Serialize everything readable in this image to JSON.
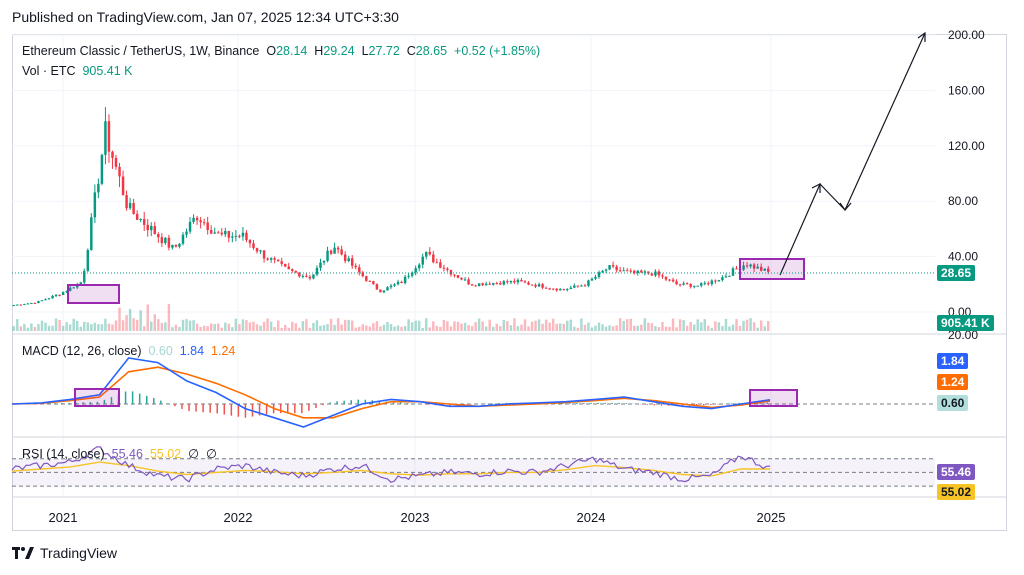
{
  "published": "Published on TradingView.com, Jan 07, 2025 12:34 UTC+3:30",
  "legend": {
    "symbol": "Ethereum Classic / TetherUS, 1W, Binance",
    "o_label": "O",
    "o": "28.14",
    "h_label": "H",
    "h": "29.24",
    "l_label": "L",
    "l": "27.72",
    "c_label": "C",
    "c": "28.65",
    "change": "+0.52 (+1.85%)",
    "vol_label": "Vol · ETC",
    "vol": "905.41 K"
  },
  "macd_legend": {
    "label": "MACD (12, 26, close)",
    "hist": "0.60",
    "macd": "1.84",
    "signal": "1.24"
  },
  "rsi_legend": {
    "label": "RSI (14, close)",
    "rsi": "55.46",
    "ma": "55.02",
    "v3": "∅",
    "v4": "∅"
  },
  "price_badge": "28.65",
  "vol_badge": "905.41 K",
  "macd_badges": [
    "1.84",
    "1.24",
    "0.60"
  ],
  "rsi_badges": [
    "55.46",
    "55.02"
  ],
  "x_labels": [
    "2021",
    "2022",
    "2023",
    "2024",
    "2025"
  ],
  "logo_text": "TradingView",
  "colors": {
    "up": "#089981",
    "down": "#f23645",
    "macd": "#2962ff",
    "signal": "#ff6d00",
    "rsi": "#7e57c2",
    "rsi_ma": "#f7c325",
    "box": "#9c27b0"
  },
  "chart_data": [
    {
      "type": "line",
      "title": "Ethereum Classic / TetherUS, 1W, Binance",
      "y_ticks": [
        0,
        40,
        80,
        120,
        160,
        200
      ],
      "y_tick_labels": [
        "0.00",
        "40.00",
        "80.00",
        "120.00",
        "160.00",
        "200.00"
      ],
      "ylim": [
        0,
        210
      ],
      "x_ticks": [
        "2021",
        "2022",
        "2023",
        "2024",
        "2025"
      ],
      "series": [
        {
          "name": "Close",
          "x": [
            "2020-11",
            "2021-01",
            "2021-03",
            "2021-04",
            "2021-05-08",
            "2021-05-20",
            "2021-06",
            "2021-07",
            "2021-08",
            "2021-09",
            "2021-10",
            "2021-12",
            "2022-01",
            "2022-03",
            "2022-04",
            "2022-05",
            "2022-06",
            "2022-07",
            "2022-08",
            "2022-09",
            "2022-11",
            "2023-01",
            "2023-04",
            "2023-06",
            "2023-09",
            "2024-01",
            "2024-03",
            "2024-04",
            "2024-06",
            "2024-08",
            "2024-10",
            "2024-11",
            "2024-12",
            "2025-01"
          ],
          "values": [
            5,
            7,
            13,
            22,
            130,
            75,
            60,
            45,
            70,
            55,
            55,
            40,
            30,
            25,
            48,
            30,
            15,
            22,
            42,
            30,
            20,
            21,
            22,
            19,
            16,
            20,
            32,
            28,
            28,
            20,
            19,
            25,
            35,
            28.65
          ]
        }
      ],
      "annotations": [
        "projection to 200.00 via 95 and 78",
        "current price 28.65"
      ]
    },
    {
      "type": "bar",
      "title": "Vol · ETC",
      "last_value": "905.41 K"
    },
    {
      "type": "line",
      "title": "MACD (12, 26, close)",
      "y_ticks": [
        20
      ],
      "y_tick_labels": [
        "20.00"
      ],
      "series": [
        {
          "name": "MACD",
          "values": [
            0,
            0.5,
            2,
            4,
            20,
            18,
            10,
            5,
            -2,
            -6,
            -10,
            -5,
            0,
            2,
            1,
            -1,
            -1,
            0,
            0.5,
            1,
            2,
            3,
            1,
            -1,
            -2,
            0,
            1.84
          ]
        },
        {
          "name": "Signal",
          "values": [
            0,
            0.3,
            1.5,
            3,
            14,
            16,
            13,
            9,
            4,
            -2,
            -6,
            -6,
            -2,
            1,
            1,
            0,
            -1,
            -0.5,
            0,
            0.7,
            1.5,
            2.5,
            1.5,
            0,
            -1.5,
            -0.5,
            1.24
          ]
        }
      ],
      "last_values": {
        "macd": 1.84,
        "signal": 1.24,
        "histogram": 0.6
      }
    },
    {
      "type": "line",
      "title": "RSI (14, close)",
      "series": [
        {
          "name": "RSI",
          "values": [
            55,
            60,
            65,
            85,
            60,
            45,
            40,
            55,
            60,
            50,
            45,
            55,
            60,
            40,
            45,
            50,
            48,
            52,
            50,
            60,
            70,
            55,
            50,
            40,
            45,
            75,
            55.46
          ]
        },
        {
          "name": "MA",
          "values": [
            52,
            55,
            58,
            65,
            60,
            52,
            47,
            50,
            53,
            51,
            48,
            50,
            53,
            48,
            46,
            48,
            48,
            50,
            50,
            54,
            60,
            57,
            53,
            47,
            45,
            55,
            55.02
          ]
        }
      ],
      "levels": [
        70,
        50,
        30
      ]
    }
  ]
}
